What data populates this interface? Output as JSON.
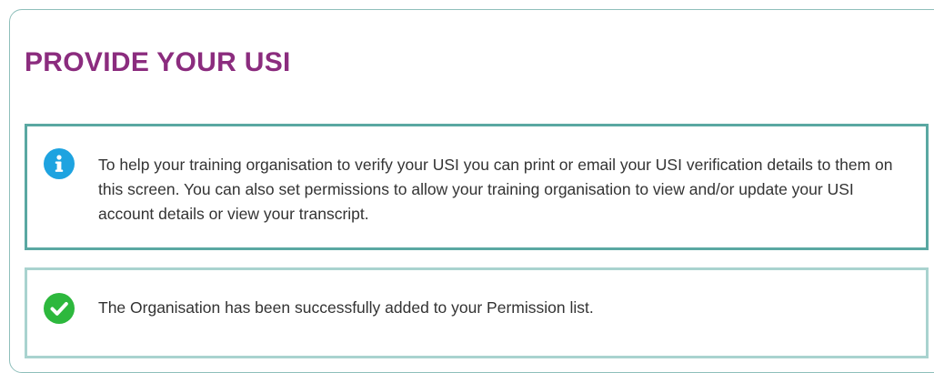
{
  "page": {
    "title": "PROVIDE YOUR USI"
  },
  "info_alert": {
    "icon": "info-icon",
    "icon_color": "#1ea3e0",
    "border_color": "#5aa8a2",
    "text": "To help your training organisation to verify your USI you can print or email your USI verification details to them on this screen. You can also set permissions to allow your training organisation to view and/or update your USI account details or view your transcript."
  },
  "success_alert": {
    "icon": "check-circle-icon",
    "icon_color": "#2db83d",
    "border_color": "#a9d3cf",
    "text": "The Organisation has been successfully added to your Permission list."
  },
  "colors": {
    "title": "#8b2c7e",
    "body_text": "#333333",
    "panel_border": "#8fbfbb"
  }
}
